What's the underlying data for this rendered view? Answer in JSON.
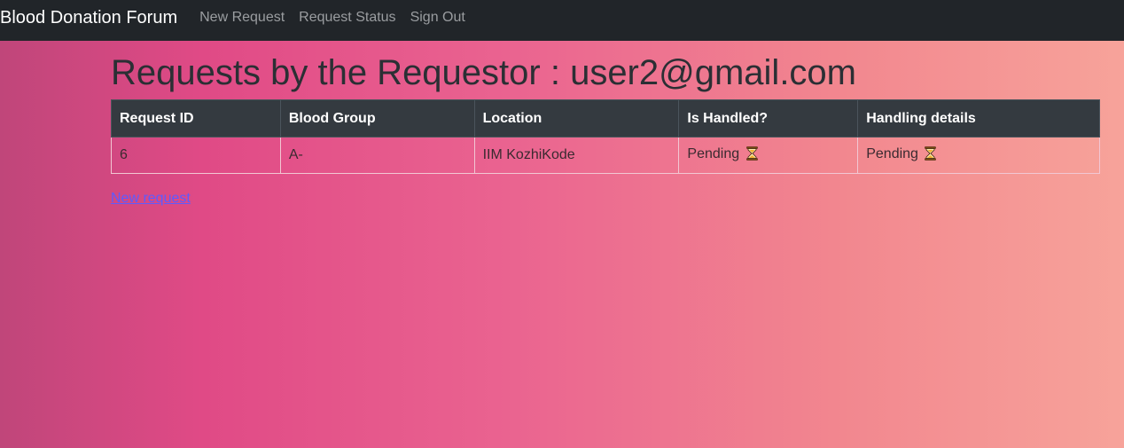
{
  "navbar": {
    "brand": "Blood Donation Forum",
    "links": [
      {
        "label": "New Request"
      },
      {
        "label": "Request Status"
      },
      {
        "label": "Sign Out"
      }
    ]
  },
  "main": {
    "title": "Requests by the Requestor : user2@gmail.com",
    "table": {
      "headers": [
        "Request ID",
        "Blood Group",
        "Location",
        "Is Handled?",
        "Handling details"
      ],
      "rows": [
        {
          "request_id": "6",
          "blood_group": "A-",
          "location": "IIM KozhiKode",
          "is_handled": "Pending",
          "is_handled_icon": "hourglass-icon",
          "handling_details": "Pending",
          "handling_details_icon": "hourglass-icon"
        }
      ]
    },
    "new_request_link": "New request"
  },
  "colors": {
    "navbar_bg": "#212529",
    "table_header_bg": "#343a40",
    "link": "#5d5bff",
    "gradient_start": "#c0467a",
    "gradient_end": "#f7a39a"
  }
}
